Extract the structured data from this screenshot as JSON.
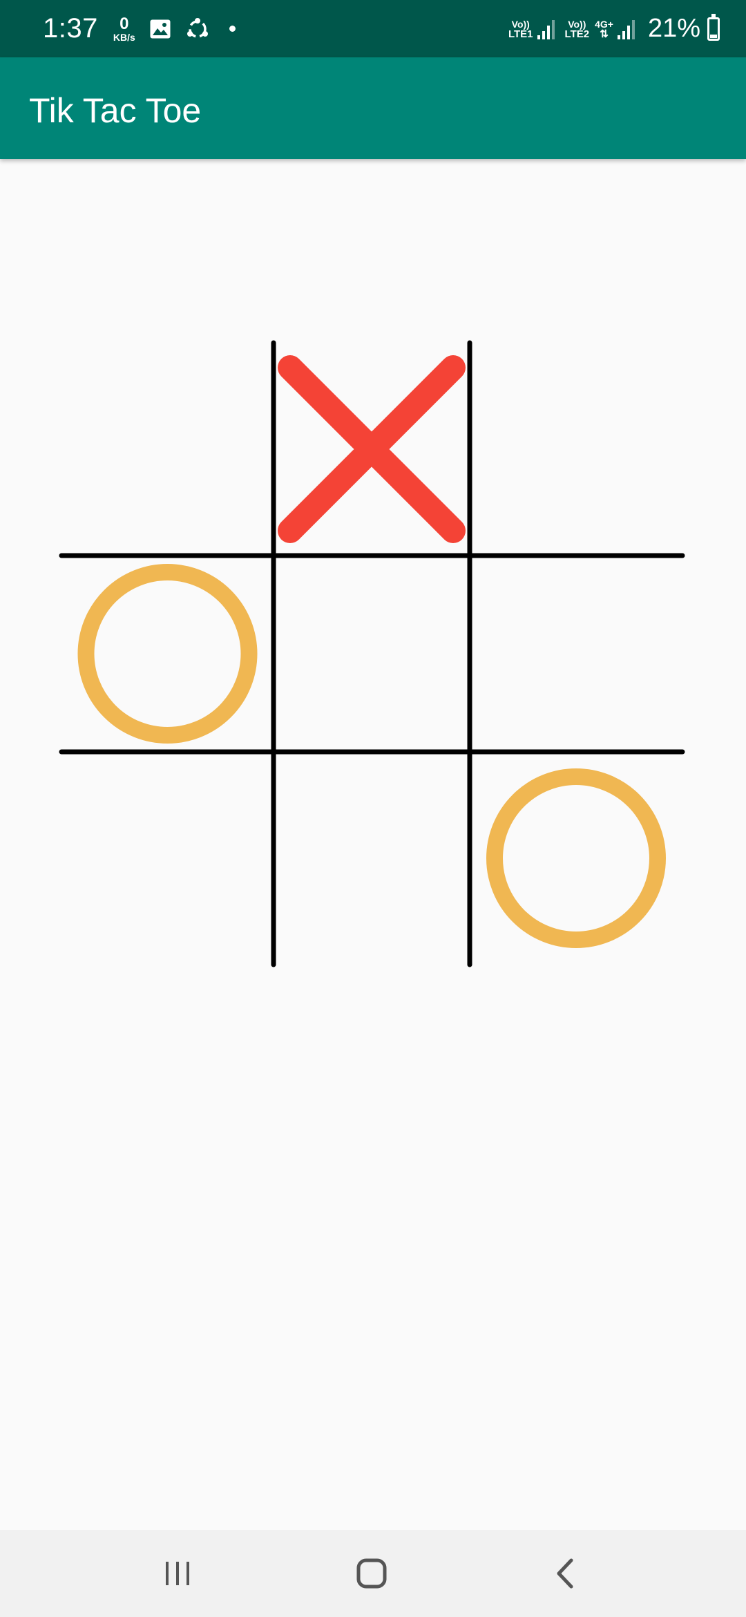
{
  "status_bar": {
    "time": "1:37",
    "net_speed_value": "0",
    "net_speed_unit": "KB/s",
    "sim1_top": "Vo))",
    "sim1_bottom": "LTE1",
    "sim2_top": "Vo))",
    "sim2_bottom": "LTE2",
    "network_type": "4G+",
    "battery_percent": "21%",
    "battery_level": 0.21,
    "icons": [
      "gallery-icon",
      "share-icon",
      "notification-dot"
    ]
  },
  "app_bar": {
    "title": "Tik Tac Toe",
    "color": "#008577",
    "status_color": "#00574b"
  },
  "game": {
    "board": [
      [
        "",
        "X",
        ""
      ],
      [
        "O",
        "",
        ""
      ],
      [
        "",
        "",
        "O"
      ]
    ],
    "colors": {
      "x": "#f44336",
      "o": "#f0b752",
      "grid": "#000000"
    }
  },
  "nav_bar": {
    "buttons": [
      "recent-apps-icon",
      "home-icon",
      "back-icon"
    ]
  }
}
